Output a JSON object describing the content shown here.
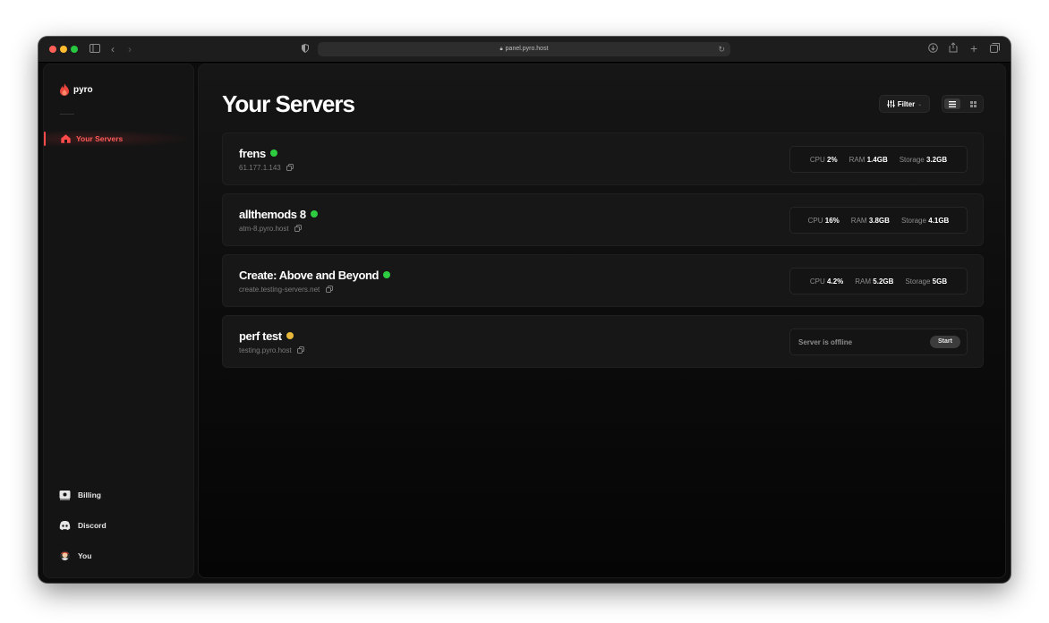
{
  "browser": {
    "url": "panel.pyro.host"
  },
  "sidebar": {
    "logo_text": "pyro",
    "nav": [
      {
        "label": "Your Servers"
      }
    ],
    "bottom": [
      {
        "label": "Billing"
      },
      {
        "label": "Discord"
      },
      {
        "label": "You"
      }
    ]
  },
  "main": {
    "title": "Your Servers",
    "filter_label": "Filter"
  },
  "servers": [
    {
      "name": "frens",
      "host": "61.177.1.143",
      "status": "online",
      "status_color": "#2ecc40",
      "stats": [
        {
          "k": "CPU",
          "v": "2%"
        },
        {
          "k": "RAM",
          "v": "1.4GB"
        },
        {
          "k": "Storage",
          "v": "3.2GB"
        }
      ]
    },
    {
      "name": "allthemods 8",
      "host": "atm-8.pyro.host",
      "status": "online",
      "status_color": "#2ecc40",
      "stats": [
        {
          "k": "CPU",
          "v": "16%"
        },
        {
          "k": "RAM",
          "v": "3.8GB"
        },
        {
          "k": "Storage",
          "v": "4.1GB"
        }
      ]
    },
    {
      "name": "Create: Above and Beyond",
      "host": "create.testing-servers.net",
      "status": "online",
      "status_color": "#2ecc40",
      "stats": [
        {
          "k": "CPU",
          "v": "4.2%"
        },
        {
          "k": "RAM",
          "v": "5.2GB"
        },
        {
          "k": "Storage",
          "v": "5GB"
        }
      ]
    },
    {
      "name": "perf test",
      "host": "testing.pyro.host",
      "status": "offline",
      "status_color": "#e8b83a",
      "offline_text": "Server is offline",
      "start_label": "Start"
    }
  ]
}
